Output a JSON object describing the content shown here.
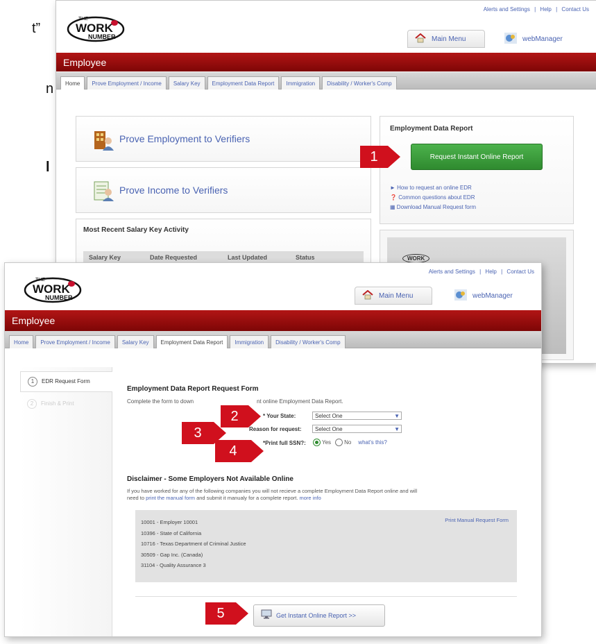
{
  "edge": {
    "t1": "t”",
    "t2": "n",
    "t3": "l"
  },
  "back": {
    "top_links": [
      "Alerts and Settings",
      "|",
      "Help",
      "|",
      "Contact Us"
    ],
    "logo": {
      "the": "THE",
      "work": "WORK",
      "number": "NUMBER"
    },
    "main_menu": "Main Menu",
    "web_manager": "webManager",
    "employee": "Employee",
    "tabs": [
      "Home",
      "Prove Employment / Income",
      "Salary Key",
      "Employment Data Report",
      "Immigration",
      "Disability / Worker's Comp"
    ],
    "prove_employment": "Prove Employment to Verifiers",
    "prove_income": "Prove Income to Verifiers",
    "recent_title": "Most Recent Salary Key Activity",
    "recent_cols": [
      "Salary Key",
      "Date Requested",
      "Last Updated",
      "Status"
    ],
    "edr_title": "Employment Data Report",
    "request_btn": "Request Instant Online Report",
    "links": [
      "How to request an online EDR",
      "Common questions about EDR",
      "Download Manual Request form"
    ],
    "promo_logo": "WORK"
  },
  "front": {
    "top_links": [
      "Alerts and Settings",
      "|",
      "Help",
      "|",
      "Contact Us"
    ],
    "logo": {
      "the": "THE",
      "work": "WORK",
      "number": "NUMBER"
    },
    "main_menu": "Main Menu",
    "web_manager": "webManager",
    "employee": "Employee",
    "tabs": [
      "Home",
      "Prove Employment / Income",
      "Salary Key",
      "Employment Data Report",
      "Immigration",
      "Disability / Worker's Comp"
    ],
    "steps": [
      {
        "num": "1",
        "label": "EDR Request Form"
      },
      {
        "num": "2",
        "label": "Finish & Print"
      }
    ],
    "form_title": "Employment Data Report Request Form",
    "form_intro_a": "Complete the form to down",
    "form_intro_b": "nt online Employment Data Report.",
    "state_label": "* Your State:",
    "state_value": "Select One",
    "reason_label": "Reason for request:",
    "reason_value": "Select One",
    "ssn_label": "*Print full SSN?:",
    "ssn_yes": "Yes",
    "ssn_no": "No",
    "whats_this": "what's this?",
    "disclaimer_title": "Disclaimer - Some Employers Not Available Online",
    "disclaimer_1": "If you have worked for any of the following companies you will not recieve a complete Employment Data Report online and will",
    "disclaimer_2a": "need to",
    "disclaimer_2_link": "print the manual form",
    "disclaimer_2b": "and submit it manualy for a complete report.",
    "more_info": "more info",
    "employers": [
      "10001 - Employer 10001",
      "10396 - State of California",
      "10716 - Texas Department of Criminal Justice",
      "30509 - Gap Inc. (Canada)",
      "31104 - Quality Assurance 3"
    ],
    "print_manual": "Print Manual Request Form",
    "get_report": "Get Instant Online Report >>"
  },
  "callouts": [
    "1",
    "2",
    "3",
    "4",
    "5"
  ],
  "colors": {
    "red": "#d0101d",
    "header_red": "#9e0d0d",
    "green": "#3a9a3a",
    "link": "#4a63b2"
  }
}
